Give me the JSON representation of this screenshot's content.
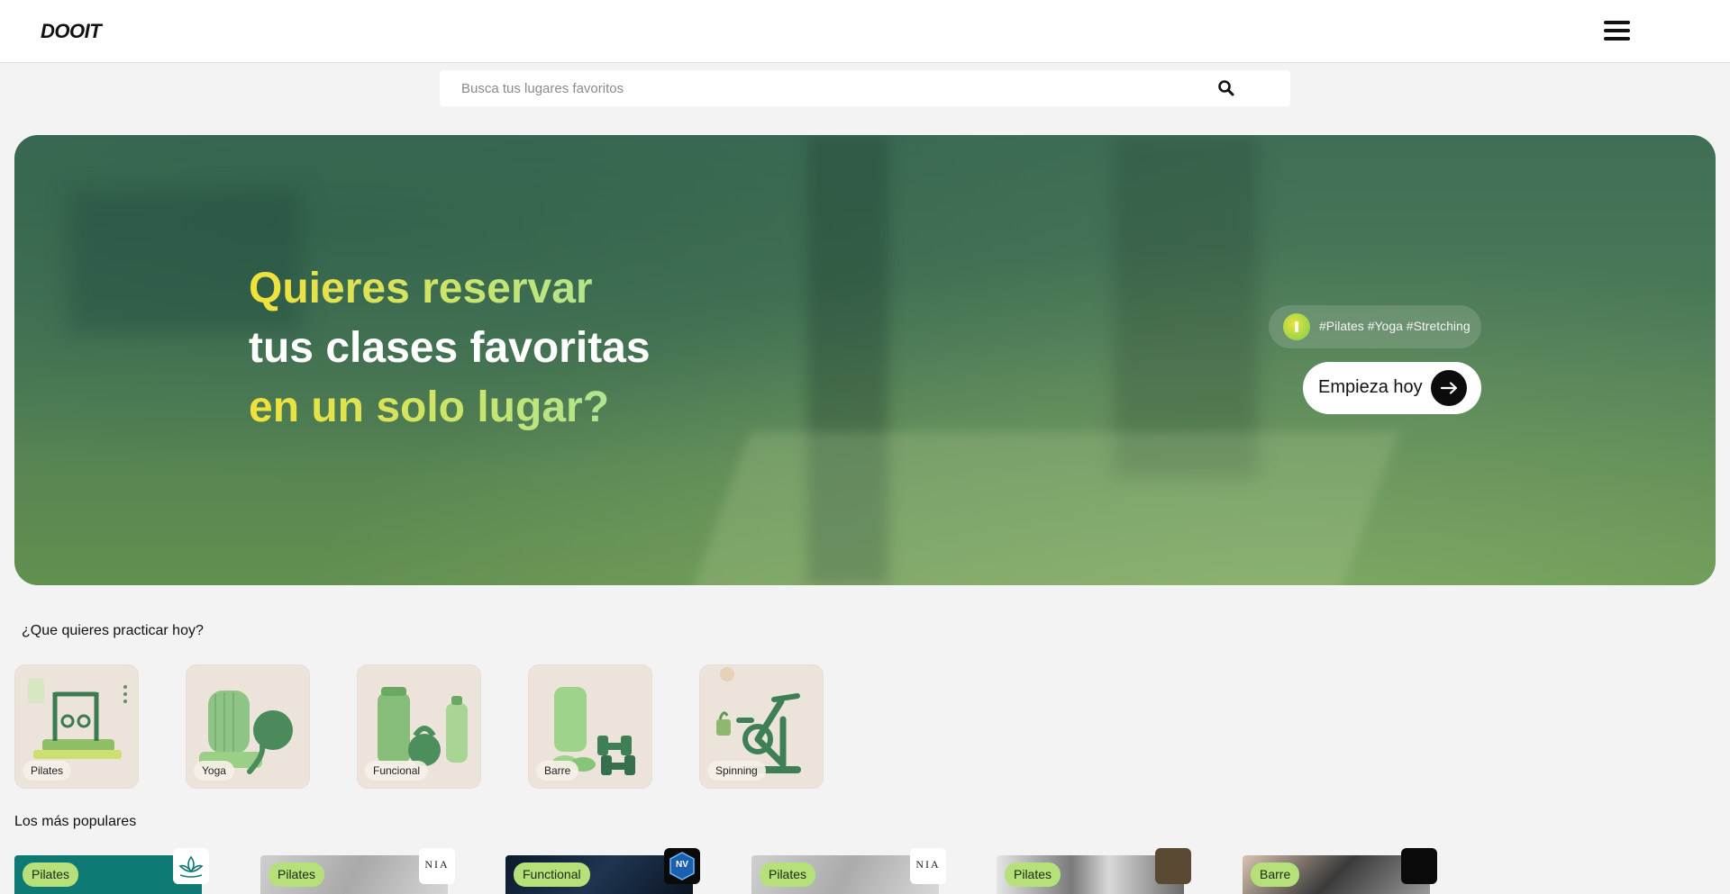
{
  "header": {
    "logo": "DOOIT",
    "menu_icon": "hamburger-menu-icon"
  },
  "search": {
    "placeholder": "Busca tus lugares favoritos",
    "icon": "search-icon"
  },
  "hero": {
    "title_line1": "Quieres reservar",
    "title_line2": "tus clases favoritas",
    "title_line3": "en un solo lugar?",
    "tags": "#Pilates #Yoga #Stretching",
    "cta_label": "Empieza hoy",
    "colors": {
      "gradient_start": "#f1e23a",
      "gradient_end": "#a9e59a",
      "hero_bg": "#4d7a57"
    }
  },
  "categories": {
    "title": "¿Que quieres practicar hoy?",
    "items": [
      {
        "label": "Pilates"
      },
      {
        "label": "Yoga"
      },
      {
        "label": "Funcional"
      },
      {
        "label": "Barre"
      },
      {
        "label": "Spinning"
      }
    ]
  },
  "popular": {
    "title": "Los más populares",
    "items": [
      {
        "tag": "Pilates"
      },
      {
        "tag": "Pilates",
        "logo_text": "NIA"
      },
      {
        "tag": "Functional",
        "logo_text": "NV"
      },
      {
        "tag": "Pilates",
        "logo_text": "NIA"
      },
      {
        "tag": "Pilates"
      },
      {
        "tag": "Barre"
      }
    ]
  }
}
